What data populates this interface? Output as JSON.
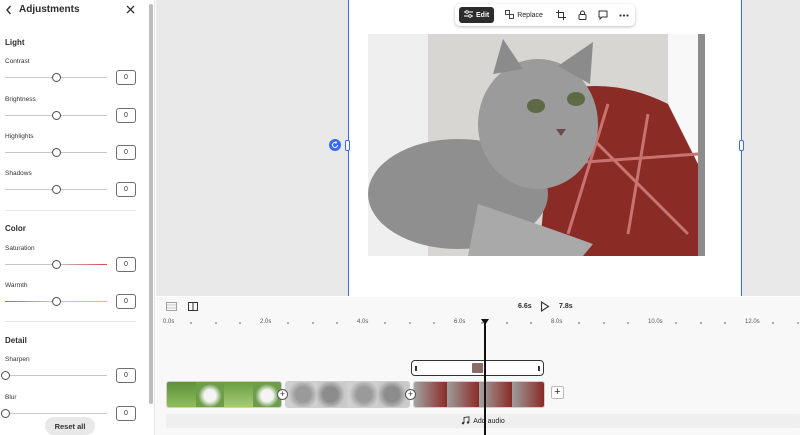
{
  "panel": {
    "title": "Adjustments",
    "sections": [
      {
        "name": "Light",
        "controls": [
          {
            "label": "Contrast",
            "value": "0",
            "level": 0.5
          },
          {
            "label": "Brightness",
            "value": "0",
            "level": 0.5
          },
          {
            "label": "Highlights",
            "value": "0",
            "level": 0.5
          },
          {
            "label": "Shadows",
            "value": "0",
            "level": 0.5
          }
        ]
      },
      {
        "name": "Color",
        "controls": [
          {
            "label": "Saturation",
            "value": "0",
            "level": 0.5
          },
          {
            "label": "Warmth",
            "value": "0",
            "level": 0.5
          }
        ]
      },
      {
        "name": "Detail",
        "controls": [
          {
            "label": "Sharpen",
            "value": "0",
            "level": 0
          },
          {
            "label": "Blur",
            "value": "0",
            "level": 0
          }
        ]
      }
    ],
    "reset_label": "Reset all"
  },
  "toolbar": {
    "edit_label": "Edit",
    "replace_label": "Replace"
  },
  "timeline": {
    "current_time": "6.6s",
    "duration": "7.8s",
    "ticks": [
      "0.0s",
      "2.0s",
      "4.0s",
      "6.0s",
      "8.0s",
      "10.0s",
      "12.0s"
    ],
    "add_audio_label": "Add audio"
  },
  "colors": {
    "accent": "#3a6af0",
    "saturation_end": "#e04545",
    "warmth_start": "#6f6ff0",
    "warmth_end": "#f0c040"
  },
  "icons": [
    "back-chevron-icon",
    "close-icon",
    "sliders-icon",
    "replace-icon",
    "crop-icon",
    "lock-icon",
    "comment-icon",
    "more-icon",
    "rotate-icon",
    "play-icon",
    "split-view-icon",
    "grid-icon",
    "music-note-icon",
    "plus-icon"
  ]
}
